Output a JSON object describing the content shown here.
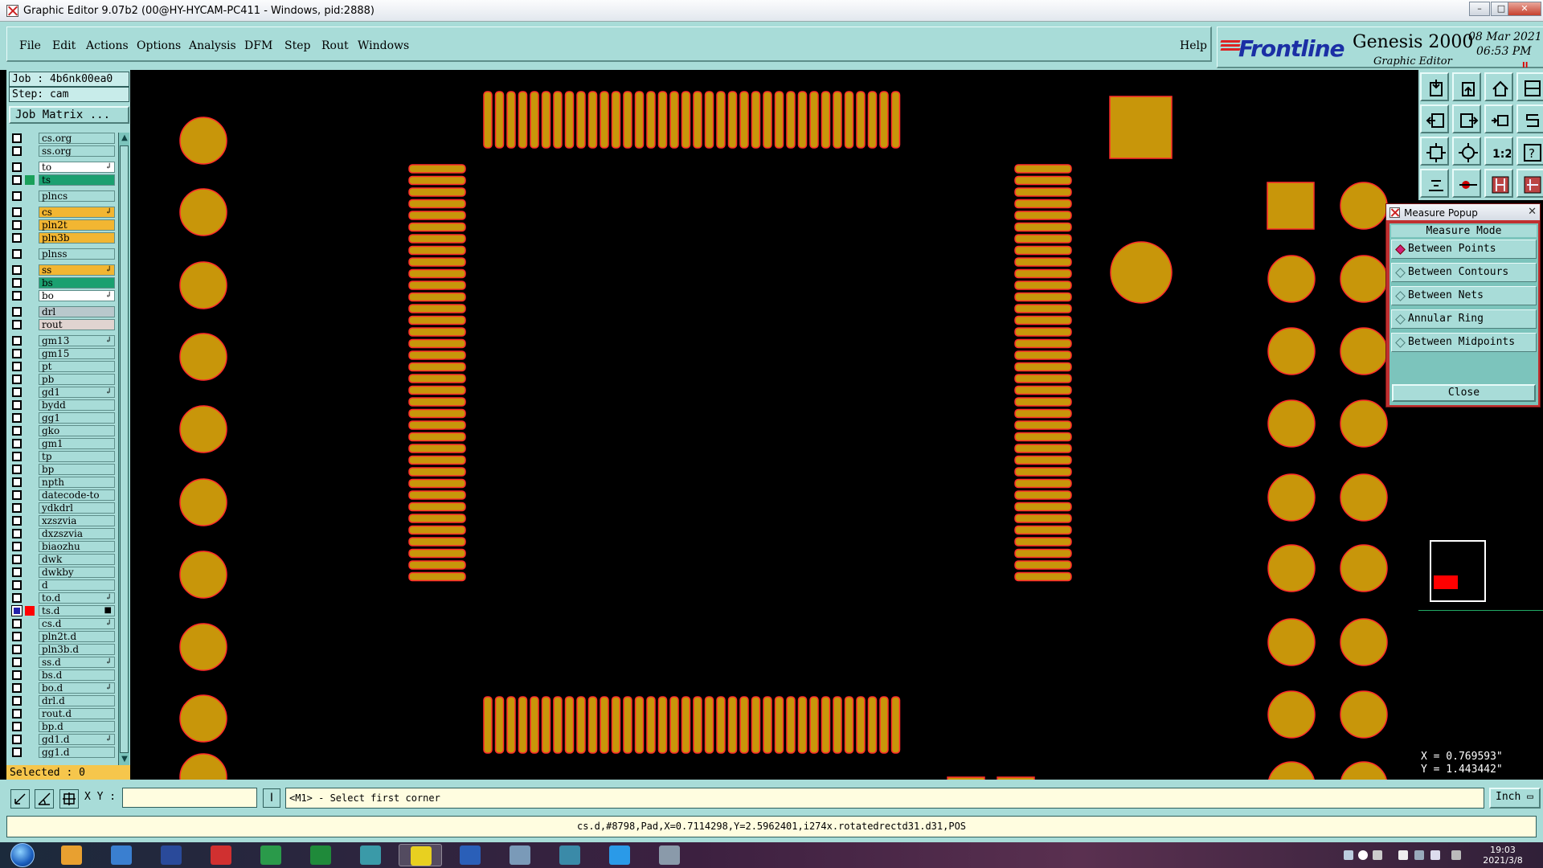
{
  "window": {
    "title": "Graphic Editor 9.07b2 (00@HY-HYCAM-PC411 - Windows, pid:2888)",
    "min_label": "–",
    "max_label": "□",
    "close_label": "✕"
  },
  "menu": {
    "items": [
      "File",
      "Edit",
      "Actions",
      "Options",
      "Analysis",
      "DFM",
      "Step",
      "Rout",
      "Windows"
    ],
    "help": "Help"
  },
  "brand": {
    "logo": "Frontline",
    "product": "Genesis 2000",
    "subtitle": "Graphic Editor",
    "date": "08 Mar 2021",
    "time": "06:53 PM",
    "pause_glyph": "II"
  },
  "job": {
    "job_label": "Job : 4b6nk00ea0",
    "step_label": "Step: cam",
    "matrix_button": "Job Matrix ..."
  },
  "layers": [
    {
      "name": "cs.org",
      "color": "",
      "bg": "#a8dcd8",
      "mark": "",
      "checked": false
    },
    {
      "name": "ss.org",
      "color": "",
      "bg": "#a8dcd8",
      "mark": "",
      "checked": false
    },
    {
      "name": "to",
      "color": "",
      "bg": "#ffffff",
      "mark": "↲",
      "checked": false,
      "gap": true
    },
    {
      "name": "ts",
      "color": "#1aa05a",
      "bg": "#1aa070",
      "mark": "",
      "checked": false
    },
    {
      "name": "plncs",
      "color": "",
      "bg": "#a8dcd8",
      "mark": "",
      "checked": false,
      "gap": true
    },
    {
      "name": "cs",
      "color": "",
      "bg": "#f2b632",
      "mark": "↲",
      "checked": false,
      "gap": true
    },
    {
      "name": "pln2t",
      "color": "",
      "bg": "#f2b632",
      "mark": "",
      "checked": false
    },
    {
      "name": "pln3b",
      "color": "",
      "bg": "#f2b632",
      "mark": "",
      "checked": false
    },
    {
      "name": "plnss",
      "color": "",
      "bg": "#a8dcd8",
      "mark": "",
      "checked": false,
      "gap": true
    },
    {
      "name": "ss",
      "color": "",
      "bg": "#f2b632",
      "mark": "↲",
      "checked": false,
      "gap": true
    },
    {
      "name": "bs",
      "color": "",
      "bg": "#1aa070",
      "mark": "",
      "checked": false
    },
    {
      "name": "bo",
      "color": "",
      "bg": "#ffffff",
      "mark": "↲",
      "checked": false
    },
    {
      "name": "drl",
      "color": "",
      "bg": "#b8c8cc",
      "mark": "",
      "checked": false,
      "gap": true
    },
    {
      "name": "rout",
      "color": "",
      "bg": "#e0d4d0",
      "mark": "",
      "checked": false
    },
    {
      "name": "gm13",
      "color": "",
      "bg": "#a8dcd8",
      "mark": "↲",
      "checked": false,
      "gap": true
    },
    {
      "name": "gm15",
      "color": "",
      "bg": "#a8dcd8",
      "mark": "",
      "checked": false
    },
    {
      "name": "pt",
      "color": "",
      "bg": "#a8dcd8",
      "mark": "",
      "checked": false
    },
    {
      "name": "pb",
      "color": "",
      "bg": "#a8dcd8",
      "mark": "",
      "checked": false
    },
    {
      "name": "gd1",
      "color": "",
      "bg": "#a8dcd8",
      "mark": "↲",
      "checked": false
    },
    {
      "name": "bydd",
      "color": "",
      "bg": "#a8dcd8",
      "mark": "",
      "checked": false
    },
    {
      "name": "gg1",
      "color": "",
      "bg": "#a8dcd8",
      "mark": "",
      "checked": false
    },
    {
      "name": "gko",
      "color": "",
      "bg": "#a8dcd8",
      "mark": "",
      "checked": false
    },
    {
      "name": "gm1",
      "color": "",
      "bg": "#a8dcd8",
      "mark": "",
      "checked": false
    },
    {
      "name": "tp",
      "color": "",
      "bg": "#a8dcd8",
      "mark": "",
      "checked": false
    },
    {
      "name": "bp",
      "color": "",
      "bg": "#a8dcd8",
      "mark": "",
      "checked": false
    },
    {
      "name": "npth",
      "color": "",
      "bg": "#a8dcd8",
      "mark": "",
      "checked": false
    },
    {
      "name": "datecode-to",
      "color": "",
      "bg": "#a8dcd8",
      "mark": "",
      "checked": false
    },
    {
      "name": "ydkdrl",
      "color": "",
      "bg": "#a8dcd8",
      "mark": "",
      "checked": false
    },
    {
      "name": "xzszvia",
      "color": "",
      "bg": "#a8dcd8",
      "mark": "",
      "checked": false
    },
    {
      "name": "dxzszvia",
      "color": "",
      "bg": "#a8dcd8",
      "mark": "",
      "checked": false
    },
    {
      "name": "biaozhu",
      "color": "",
      "bg": "#a8dcd8",
      "mark": "",
      "checked": false
    },
    {
      "name": "dwk",
      "color": "",
      "bg": "#a8dcd8",
      "mark": "",
      "checked": false
    },
    {
      "name": "dwkby",
      "color": "",
      "bg": "#a8dcd8",
      "mark": "",
      "checked": false
    },
    {
      "name": "d",
      "color": "",
      "bg": "#a8dcd8",
      "mark": "",
      "checked": false
    },
    {
      "name": "to.d",
      "color": "",
      "bg": "#a8dcd8",
      "mark": "↲",
      "checked": false
    },
    {
      "name": "ts.d",
      "color": "#ff0000",
      "bg": "#a8dcd8",
      "mark": "■",
      "checked": true
    },
    {
      "name": "cs.d",
      "color": "",
      "bg": "#a8dcd8",
      "mark": "↲",
      "checked": false
    },
    {
      "name": "pln2t.d",
      "color": "",
      "bg": "#a8dcd8",
      "mark": "",
      "checked": false
    },
    {
      "name": "pln3b.d",
      "color": "",
      "bg": "#a8dcd8",
      "mark": "",
      "checked": false
    },
    {
      "name": "ss.d",
      "color": "",
      "bg": "#a8dcd8",
      "mark": "↲",
      "checked": false
    },
    {
      "name": "bs.d",
      "color": "",
      "bg": "#a8dcd8",
      "mark": "",
      "checked": false
    },
    {
      "name": "bo.d",
      "color": "",
      "bg": "#a8dcd8",
      "mark": "↲",
      "checked": false
    },
    {
      "name": "drl.d",
      "color": "",
      "bg": "#a8dcd8",
      "mark": "",
      "checked": false
    },
    {
      "name": "rout.d",
      "color": "",
      "bg": "#a8dcd8",
      "mark": "",
      "checked": false
    },
    {
      "name": "bp.d",
      "color": "",
      "bg": "#a8dcd8",
      "mark": "",
      "checked": false
    },
    {
      "name": "gd1.d",
      "color": "",
      "bg": "#a8dcd8",
      "mark": "↲",
      "checked": false
    },
    {
      "name": "gg1.d",
      "color": "",
      "bg": "#a8dcd8",
      "mark": "",
      "checked": false
    }
  ],
  "selected": "Selected : 0",
  "measure": {
    "title": "Measure Popup",
    "mode_header": "Measure Mode",
    "options": [
      "Between Points",
      "Between Contours",
      "Between Nets",
      "Annular Ring",
      "Between Midpoints"
    ],
    "selected_index": 0,
    "close": "Close",
    "close_x": "✕"
  },
  "tools": [
    "zoom-in-icon",
    "zoom-out-icon",
    "home-icon",
    "window-icon",
    "pan-left-icon",
    "pan-right-icon",
    "zoom-area-icon",
    "redraw-icon",
    "fit-all-icon",
    "fit-step-icon",
    "one-to-one-icon",
    "help-icon",
    "snap-icon",
    "measure-icon",
    "net-measure-icon",
    "layer-measure-icon"
  ],
  "coords": {
    "x": "X = 0.769593\"",
    "y": "Y = 1.443442\""
  },
  "command": {
    "xy_label": "X Y :",
    "xy_value": "",
    "xy_button": "I",
    "prompt": "<M1> - Select first corner",
    "units": "Inch",
    "units_arrow": "▭"
  },
  "status": "cs.d,#8798,Pad,X=0.7114298,Y=2.5962401,i274x.rotatedrectd31.d31,POS",
  "board": {
    "pad_color": "#c8960a",
    "outline_color": "#ff2a2a"
  },
  "taskbar": {
    "apps": [
      "start-icon",
      "shell-icon",
      "notepad-icon",
      "save-icon",
      "redapp-icon",
      "green-p-icon",
      "excel-icon",
      "fish-icon",
      "genesis-icon",
      "word-icon",
      "notes-icon",
      "fish2-icon",
      "arrow-app-icon",
      "calculator-icon"
    ],
    "time": "19:03",
    "date": "2021/3/8"
  }
}
